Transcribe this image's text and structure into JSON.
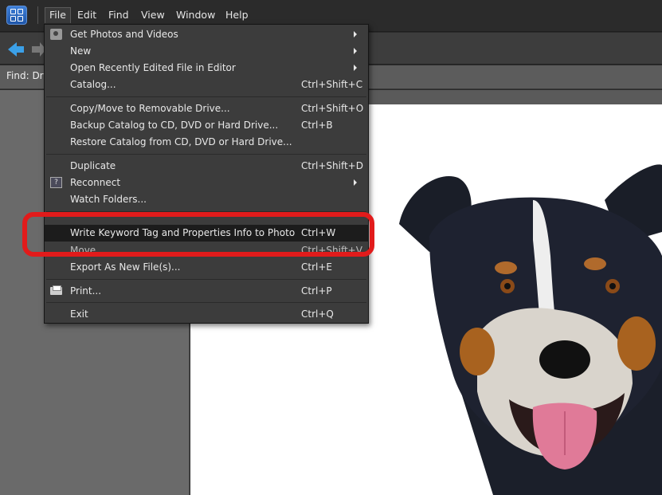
{
  "menubar": {
    "items": [
      "File",
      "Edit",
      "Find",
      "View",
      "Window",
      "Help"
    ]
  },
  "findbar": {
    "label": "Find: Dr"
  },
  "file_menu": {
    "items": [
      {
        "label": "Get Photos and Videos",
        "shortcut": "",
        "submenu": true,
        "icon": "camera-icon"
      },
      {
        "label": "New",
        "shortcut": "",
        "submenu": true
      },
      {
        "label": "Open Recently Edited File in Editor",
        "shortcut": "",
        "submenu": true
      },
      {
        "label": "Catalog...",
        "shortcut": "Ctrl+Shift+C"
      },
      {
        "label": "Copy/Move to Removable Drive...",
        "shortcut": "Ctrl+Shift+O"
      },
      {
        "label": "Backup Catalog to CD, DVD or Hard Drive...",
        "shortcut": "Ctrl+B"
      },
      {
        "label": "Restore Catalog from CD, DVD or Hard Drive...",
        "shortcut": ""
      },
      {
        "label": "Duplicate",
        "shortcut": "Ctrl+Shift+D"
      },
      {
        "label": "Reconnect",
        "shortcut": "",
        "submenu": true,
        "icon": "question-icon"
      },
      {
        "label": "Watch Folders...",
        "shortcut": ""
      },
      {
        "label": "Write Keyword Tag and Properties Info to Photo",
        "shortcut": "Ctrl+W",
        "highlighted": true
      },
      {
        "label": "Move",
        "shortcut": "Ctrl+Shift+V"
      },
      {
        "label": "Export As New File(s)...",
        "shortcut": "Ctrl+E"
      },
      {
        "label": "Print...",
        "shortcut": "Ctrl+P",
        "icon": "printer-icon"
      },
      {
        "label": "Exit",
        "shortcut": "Ctrl+Q"
      }
    ]
  },
  "colors": {
    "highlight_ring": "#e11b1b",
    "menu_bg": "#3c3c3c",
    "menu_highlight": "#1c1c1c",
    "nav_arrow": "#3ba0e8"
  }
}
